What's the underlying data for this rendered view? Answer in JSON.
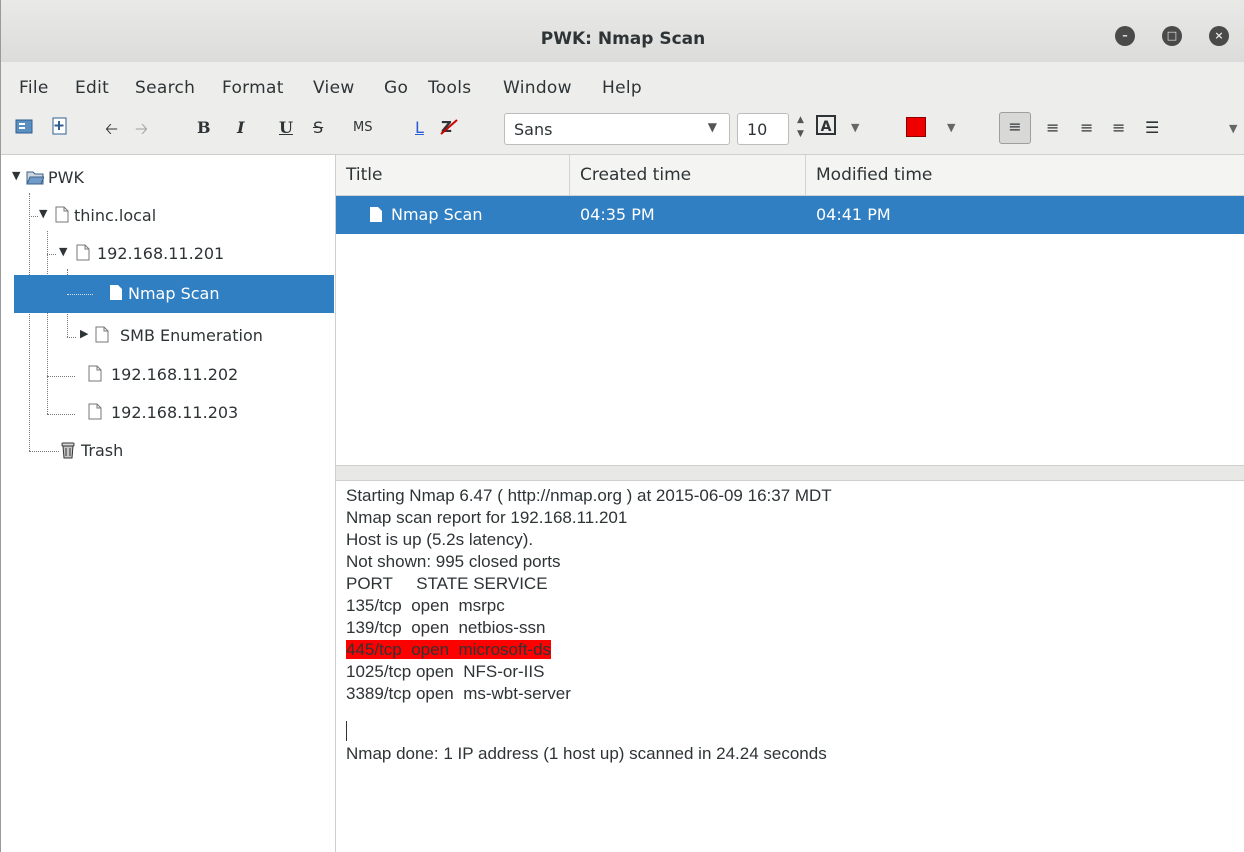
{
  "window": {
    "title": "PWK: Nmap Scan",
    "controls": [
      "minimize",
      "maximize",
      "close"
    ]
  },
  "menu": [
    "File",
    "Edit",
    "Search",
    "Format",
    "View",
    "Go",
    "Tools",
    "Window",
    "Help"
  ],
  "toolbar": {
    "bold": "B",
    "italic": "I",
    "underline": "U",
    "strike": "S",
    "monospace": "MS",
    "link": "L",
    "font_family": "Sans",
    "font_size": "10",
    "text_color_label": "A",
    "highlight_color": "#ee0000"
  },
  "tree": [
    {
      "label": "PWK",
      "level": 0,
      "icon": "folder-open-icon",
      "expanded": true
    },
    {
      "label": "thinc.local",
      "level": 1,
      "icon": "page-icon",
      "expanded": true
    },
    {
      "label": "192.168.11.201",
      "level": 2,
      "icon": "page-icon",
      "expanded": true
    },
    {
      "label": "Nmap Scan",
      "level": 3,
      "icon": "page-filled-icon",
      "selected": true
    },
    {
      "label": "SMB Enumeration",
      "level": 3,
      "icon": "page-icon",
      "expanded": false
    },
    {
      "label": "192.168.11.202",
      "level": 2,
      "icon": "page-icon"
    },
    {
      "label": "192.168.11.203",
      "level": 2,
      "icon": "page-icon"
    },
    {
      "label": "Trash",
      "level": 1,
      "icon": "trash-icon"
    }
  ],
  "table": {
    "columns": [
      "Title",
      "Created time",
      "Modified time"
    ],
    "rows": [
      {
        "title": "Nmap Scan",
        "created": "04:35 PM",
        "modified": "04:41 PM"
      }
    ]
  },
  "editor": {
    "lines": [
      "Starting Nmap 6.47 ( http://nmap.org ) at 2015-06-09 16:37 MDT",
      "Nmap scan report for 192.168.11.201",
      "Host is up (5.2s latency).",
      "Not shown: 995 closed ports",
      "PORT     STATE SERVICE",
      "135/tcp  open  msrpc",
      "139/tcp  open  netbios-ssn",
      "445/tcp  open  microsoft-ds",
      "1025/tcp open  NFS-or-IIS",
      "3389/tcp open  ms-wbt-server",
      "",
      "Nmap done: 1 IP address (1 host up) scanned in 24.24 seconds"
    ],
    "highlight_color": "#ff0000"
  }
}
